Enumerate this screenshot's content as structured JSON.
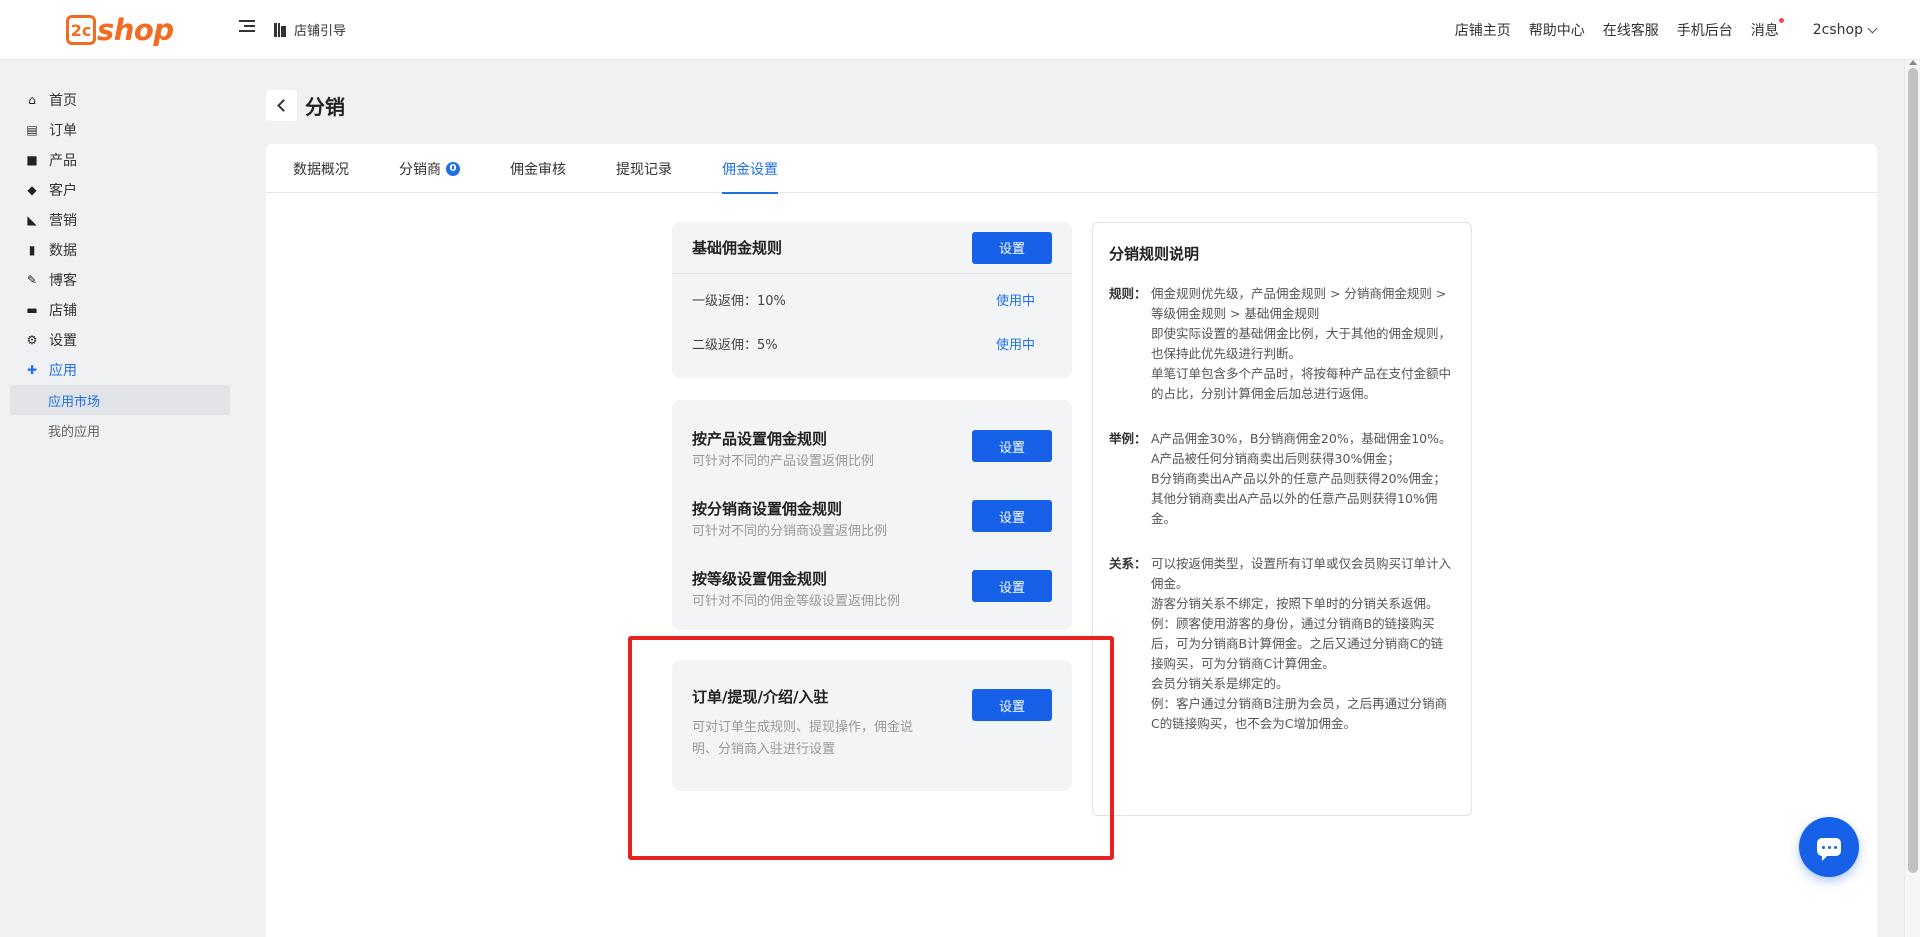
{
  "header": {
    "logo_badge": "2c",
    "logo_text": "shop",
    "guide_label": "店铺引导",
    "links": [
      "店铺主页",
      "帮助中心",
      "在线客服",
      "手机后台",
      "消息"
    ],
    "user": "2cshop"
  },
  "sidebar": {
    "items": [
      {
        "label": "首页",
        "icon": "home-icon"
      },
      {
        "label": "订单",
        "icon": "order-icon"
      },
      {
        "label": "产品",
        "icon": "bag-icon"
      },
      {
        "label": "客户",
        "icon": "gem-icon"
      },
      {
        "label": "营销",
        "icon": "tag-icon"
      },
      {
        "label": "数据",
        "icon": "chart-icon"
      },
      {
        "label": "博客",
        "icon": "edit-icon"
      },
      {
        "label": "店铺",
        "icon": "store-icon"
      },
      {
        "label": "设置",
        "icon": "gear-icon"
      },
      {
        "label": "应用",
        "icon": "puzzle-icon"
      }
    ],
    "sub_items": [
      "应用市场",
      "我的应用"
    ]
  },
  "page": {
    "title": "分销"
  },
  "tabs": [
    {
      "label": "数据概况"
    },
    {
      "label": "分销商",
      "badge": "0"
    },
    {
      "label": "佣金审核"
    },
    {
      "label": "提现记录"
    },
    {
      "label": "佣金设置"
    }
  ],
  "basic_rule": {
    "title": "基础佣金规则",
    "button": "设置",
    "rows": [
      {
        "label": "一级返佣：10%",
        "status": "使用中"
      },
      {
        "label": "二级返佣：5%",
        "status": "使用中"
      }
    ]
  },
  "custom_rules": [
    {
      "title": "按产品设置佣金规则",
      "desc": "可针对不同的产品设置返佣比例",
      "button": "设置"
    },
    {
      "title": "按分销商设置佣金规则",
      "desc": "可针对不同的分销商设置返佣比例",
      "button": "设置"
    },
    {
      "title": "按等级设置佣金规则",
      "desc": "可针对不同的佣金等级设置返佣比例",
      "button": "设置"
    }
  ],
  "order_rule": {
    "title": "订单/提现/介绍/入驻",
    "desc": "可对订单生成规则、提现操作，佣金说明、分销商入驻进行设置",
    "button": "设置"
  },
  "help": {
    "title": "分销规则说明",
    "sections": [
      {
        "label": "规则：",
        "lines": [
          "佣金规则优先级，产品佣金规则 > 分销商佣金规则 > 等级佣金规则 > 基础佣金规则",
          "即使实际设置的基础佣金比例，大于其他的佣金规则，也保持此优先级进行判断。",
          "单笔订单包含多个产品时，将按每种产品在支付金额中的占比，分别计算佣金后加总进行返佣。"
        ]
      },
      {
        "label": "举例：",
        "lines": [
          "A产品佣金30%，B分销商佣金20%，基础佣金10%。",
          "A产品被任何分销商卖出后则获得30%佣金；",
          "B分销商卖出A产品以外的任意产品则获得20%佣金；",
          "其他分销商卖出A产品以外的任意产品则获得10%佣金。"
        ]
      },
      {
        "label": "关系：",
        "lines": [
          "可以按返佣类型，设置所有订单或仅会员购买订单计入佣金。",
          "游客分销关系不绑定，按照下单时的分销关系返佣。",
          "例：顾客使用游客的身份，通过分销商B的链接购买后，可为分销商B计算佣金。之后又通过分销商C的链接购买，可为分销商C计算佣金。",
          "会员分销关系是绑定的。",
          "例：客户通过分销商B注册为会员，之后再通过分销商C的链接购买，也不会为C增加佣金。"
        ]
      }
    ]
  },
  "colors": {
    "accent": "#1760e8",
    "brand": "#f26b21",
    "highlight": "#e4231e"
  }
}
